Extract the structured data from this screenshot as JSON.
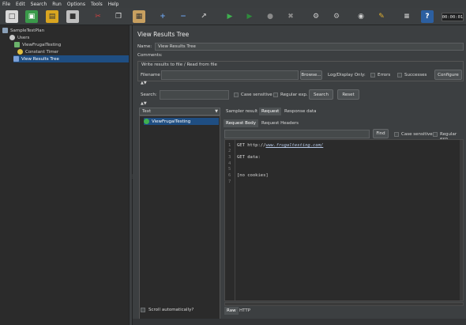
{
  "menu": [
    "File",
    "Edit",
    "Search",
    "Run",
    "Options",
    "Tools",
    "Help"
  ],
  "toolbar": {
    "buttons": [
      {
        "name": "new-icon",
        "glyph": "□",
        "bg": "#d8d8d8",
        "fg": "#333"
      },
      {
        "name": "templates-icon",
        "glyph": "▣",
        "bg": "#3a9a4a",
        "fg": "#fff"
      },
      {
        "name": "open-icon",
        "glyph": "▤",
        "bg": "#d9a520",
        "fg": "#333"
      },
      {
        "name": "save-icon",
        "glyph": "■",
        "bg": "#bfbfbf",
        "fg": "#333"
      },
      {
        "name": "cut-icon",
        "glyph": "✂",
        "bg": "#3c3f41",
        "fg": "#d04040"
      },
      {
        "name": "copy-icon",
        "glyph": "❐",
        "bg": "#3c3f41",
        "fg": "#e0e0e0"
      },
      {
        "name": "paste-icon",
        "glyph": "▦",
        "bg": "#c8a060",
        "fg": "#333"
      },
      {
        "name": "expand-icon",
        "glyph": "+",
        "bg": "#3c3f41",
        "fg": "#6ba0e8"
      },
      {
        "name": "collapse-icon",
        "glyph": "−",
        "bg": "#3c3f41",
        "fg": "#6ba0e8"
      },
      {
        "name": "toggle-icon",
        "glyph": "↗",
        "bg": "#3c3f41",
        "fg": "#c0c0c0"
      },
      {
        "name": "start-icon",
        "glyph": "▶",
        "bg": "#3c3f41",
        "fg": "#3fb04f"
      },
      {
        "name": "start-no-pause-icon",
        "glyph": "▶",
        "bg": "#3c3f41",
        "fg": "#2e8a3c"
      },
      {
        "name": "stop-icon",
        "glyph": "●",
        "bg": "#3c3f41",
        "fg": "#8a8a8a"
      },
      {
        "name": "shutdown-icon",
        "glyph": "✖",
        "bg": "#3c3f41",
        "fg": "#8a8a8a"
      },
      {
        "name": "clear-icon",
        "glyph": "⚙",
        "bg": "#3c3f41",
        "fg": "#d0d0d0"
      },
      {
        "name": "clear-all-icon",
        "glyph": "⚙",
        "bg": "#3c3f41",
        "fg": "#bdbdbd"
      },
      {
        "name": "search-icon",
        "glyph": "◉",
        "bg": "#3c3f41",
        "fg": "#cfcfcf"
      },
      {
        "name": "reset-search-icon",
        "glyph": "✎",
        "bg": "#3c3f41",
        "fg": "#e0b030"
      },
      {
        "name": "function-helper-icon",
        "glyph": "≡",
        "bg": "#3c3f41",
        "fg": "#e0e0e0"
      },
      {
        "name": "help-icon",
        "glyph": "?",
        "bg": "#2c5fa0",
        "fg": "#fff"
      }
    ],
    "timer": "00:00:01"
  },
  "tree": {
    "nodes": [
      {
        "label": "SampleTestPlan",
        "color": "#8aa0b8",
        "selected": false
      },
      {
        "label": "Users",
        "color": "#c9c9c9",
        "selected": false
      },
      {
        "label": "ViewFrugalTesting",
        "color": "#6bb36b",
        "selected": false
      },
      {
        "label": "Constant Timer",
        "color": "#e0c040",
        "selected": false
      },
      {
        "label": "View Results Tree",
        "color": "#7b9fd6",
        "selected": true
      }
    ]
  },
  "panel": {
    "title": "View Results Tree",
    "name_label": "Name:",
    "name_value": "View Results Tree",
    "comments_label": "Comments:",
    "file_group": "Write results to file / Read from file",
    "filename_label": "Filename",
    "browse": "Browse...",
    "log_label": "Log/Display Only:",
    "errors": "Errors",
    "successes": "Successes",
    "configure": "Configure",
    "search_label": "Search:",
    "case_sensitive": "Case sensitive",
    "regex": "Regular exp.",
    "search_btn": "Search",
    "reset_btn": "Reset",
    "renderer": "Text",
    "result_item": "ViewFrugalTesting",
    "scroll_auto": "Scroll automatically?",
    "tabs": [
      "Sampler result",
      "Request",
      "Response data"
    ],
    "subtabs": [
      "Request Body",
      "Request Headers"
    ],
    "find_btn": "Find",
    "bottom_tabs": [
      "Raw",
      "HTTP"
    ]
  },
  "editor": {
    "line_numbers": [
      "1",
      "2",
      "3",
      "4",
      "5",
      "6",
      "7"
    ],
    "get_prefix": "GET http://",
    "get_url": "www.frugaltesting.com/",
    "get_data": "GET data:",
    "no_cookies": "[no cookies]"
  }
}
